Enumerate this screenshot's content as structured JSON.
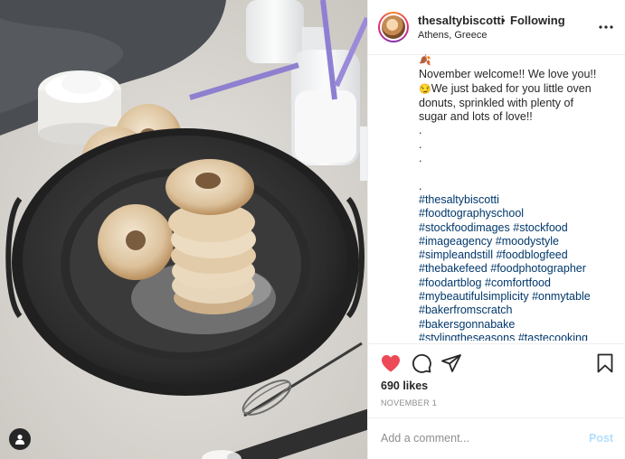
{
  "header": {
    "username": "thesaltybiscotti",
    "separator": "•",
    "follow_status": "Following",
    "location": "Athens, Greece"
  },
  "caption": {
    "lines": [
      "November welcome!! We love you!!",
      "We just baked for you little oven",
      "donuts, sprinkled with plenty of",
      "sugar and lots of love!!",
      ".",
      ".",
      ".",
      "",
      "."
    ],
    "hashtag_lines": [
      [
        "#thesaltybiscotti"
      ],
      [
        "#foodtographyschool"
      ],
      [
        "#stockfoodimages",
        "#stockfood"
      ],
      [
        "#imageagency",
        "#moodystyle"
      ],
      [
        "#simpleandstill",
        "#foodblogfeed"
      ],
      [
        "#thebakefeed",
        "#foodphotographer"
      ],
      [
        "#foodartblog",
        "#comfortfood"
      ],
      [
        "#mybeautifulsimplicity",
        "#onmytable"
      ],
      [
        "#bakerfromscratch"
      ],
      [
        "#bakersgonnabake"
      ],
      [
        "#stylingtheseasons",
        "#tastecooking"
      ]
    ],
    "leaf_emoji": "🍂",
    "smile_emoji": "😏"
  },
  "actions": {
    "like_icon": "heart-filled-icon",
    "comment_icon": "comment-bubble-icon",
    "share_icon": "paper-plane-icon",
    "save_icon": "bookmark-icon",
    "like_color": "#ed4956"
  },
  "likes": "690 likes",
  "date": "NOVEMBER 1",
  "comment": {
    "placeholder": "Add a comment...",
    "post_label": "Post"
  },
  "colors": {
    "hashtag": "#00376b",
    "post_disabled": "#b2dffc",
    "secondary_text": "#8e8e8e"
  }
}
